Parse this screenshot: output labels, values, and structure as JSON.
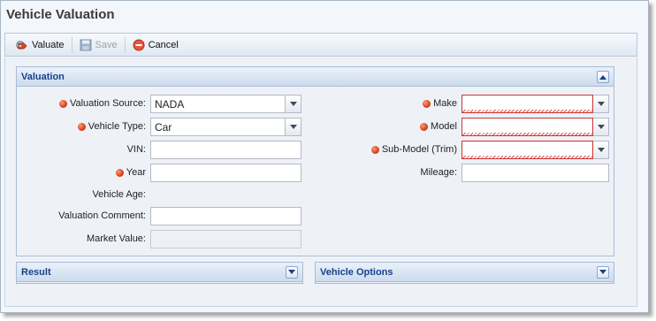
{
  "window": {
    "title": "Vehicle Valuation"
  },
  "toolbar": {
    "valuate_label": "Valuate",
    "save_label": "Save",
    "cancel_label": "Cancel"
  },
  "valuation_panel": {
    "title": "Valuation",
    "fields": {
      "valuation_source": {
        "label": "Valuation Source:",
        "value": "NADA"
      },
      "vehicle_type": {
        "label": "Vehicle Type:",
        "value": "Car"
      },
      "vin": {
        "label": "VIN:",
        "value": ""
      },
      "year": {
        "label": "Year",
        "value": ""
      },
      "vehicle_age": {
        "label": "Vehicle Age:",
        "value": ""
      },
      "valuation_comment": {
        "label": "Valuation Comment:",
        "value": ""
      },
      "market_value": {
        "label": "Market Value:",
        "value": ""
      },
      "make": {
        "label": "Make",
        "value": ""
      },
      "model": {
        "label": "Model",
        "value": ""
      },
      "sub_model": {
        "label": "Sub-Model (Trim)",
        "value": ""
      },
      "mileage": {
        "label": "Mileage:",
        "value": ""
      }
    }
  },
  "result_panel": {
    "title": "Result"
  },
  "vehicle_options_panel": {
    "title": "Vehicle Options"
  },
  "colors": {
    "panel_title": "#15428b",
    "required_indicator": "#d9401a",
    "invalid_border": "#cc3333"
  }
}
